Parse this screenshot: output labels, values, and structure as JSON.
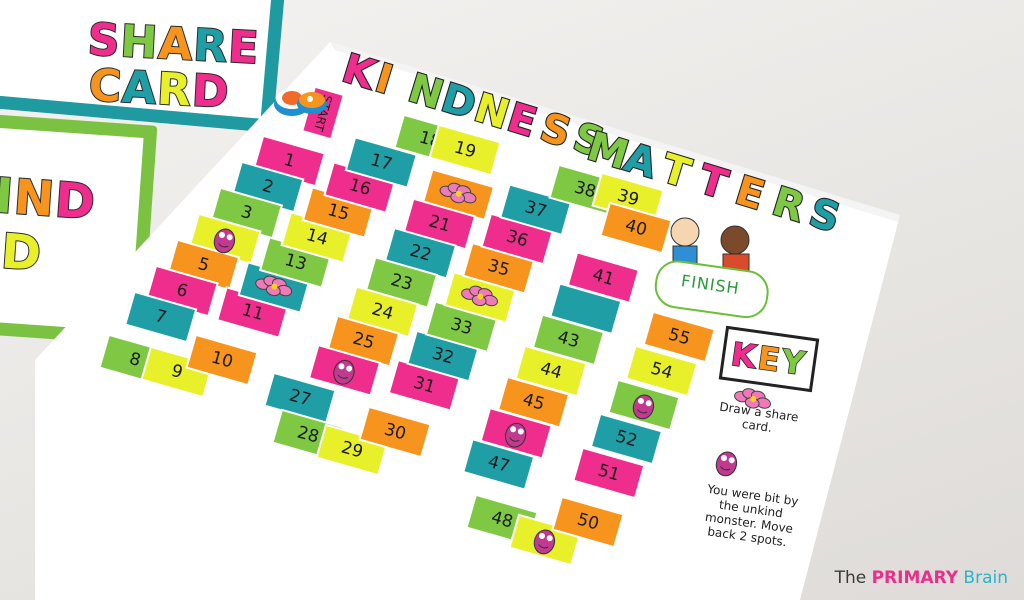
{
  "cards": {
    "share": {
      "line1": "SHARE",
      "line2": "CARD"
    },
    "kind": {
      "line1": "IND",
      "line2": "D"
    }
  },
  "board": {
    "title_word1": "KINDNESS",
    "title_word2": "MATTERS",
    "start_label": "START",
    "finish_label": "FINISH",
    "squares": [
      "1",
      "2",
      "3",
      "",
      "5",
      "6",
      "7",
      "8",
      "9",
      "10",
      "11",
      "",
      "13",
      "14",
      "15",
      "16",
      "17",
      "18",
      "19",
      "",
      "21",
      "22",
      "23",
      "24",
      "25",
      "",
      "27",
      "28",
      "29",
      "30",
      "31",
      "32",
      "33",
      "",
      "35",
      "36",
      "37",
      "38",
      "39",
      "40",
      "41",
      "",
      "43",
      "44",
      "45",
      "",
      "47",
      "48",
      "",
      "50",
      "51",
      "52",
      "",
      "54",
      "55"
    ],
    "key": {
      "heading": "KEY",
      "flower_rule": "Draw a share card.",
      "monster_rule": "You were bit by the unkind monster. Move back 2 spots."
    }
  },
  "brand": {
    "prefix": "The",
    "highlight": "PRIMARY",
    "suffix": "Brain"
  },
  "colors": {
    "pink": "#ee2d8c",
    "teal": "#1f9ea6",
    "green": "#7ec843",
    "yellow": "#e8f02a",
    "orange": "#f7941d",
    "deck_share": "#1e9aa0",
    "deck_kind": "#7cc242"
  },
  "icons": [
    "flower-icon",
    "monster-icon",
    "kids-illustration-icon",
    "game-token-icon"
  ]
}
